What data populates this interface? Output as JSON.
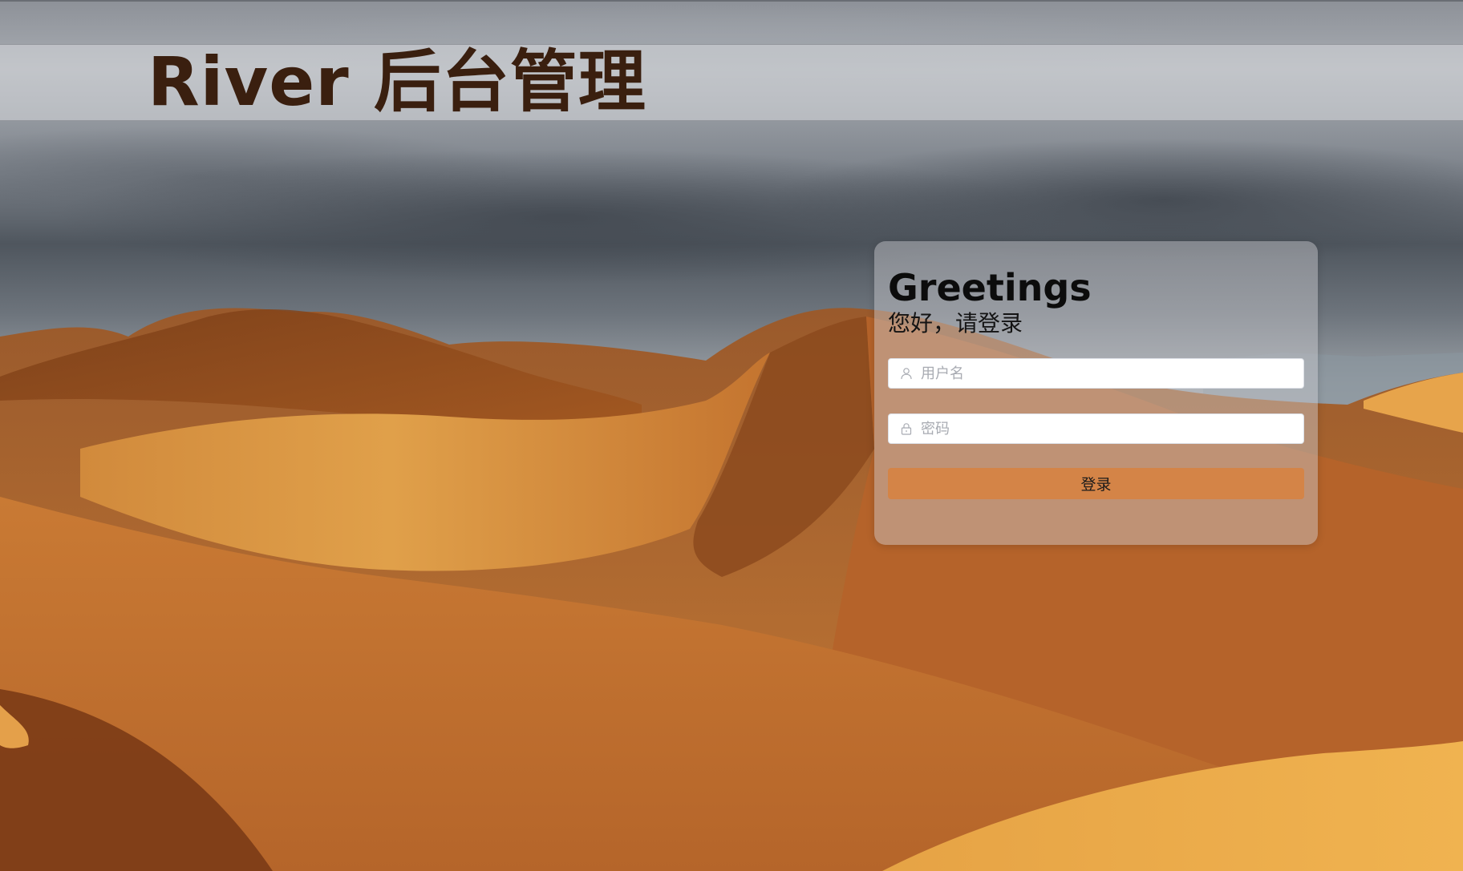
{
  "header": {
    "title": "River 后台管理"
  },
  "login": {
    "greeting": "Greetings",
    "subtitle": "您好，请登录",
    "username": {
      "placeholder": "用户名",
      "value": "",
      "icon": "user-icon"
    },
    "password": {
      "placeholder": "密码",
      "value": "",
      "icon": "lock-icon"
    },
    "submit_label": "登录"
  },
  "colors": {
    "title_text": "#3a1f0f",
    "button_bg": "#d48447",
    "card_bg": "rgba(205,205,208,0.45)",
    "header_band": "rgba(215,217,221,0.55)"
  }
}
